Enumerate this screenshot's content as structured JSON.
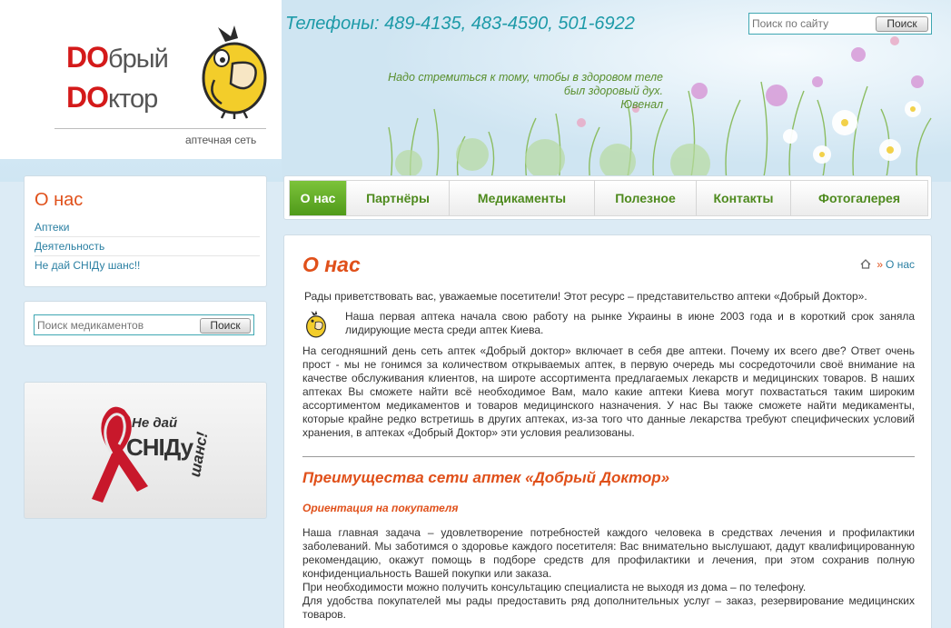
{
  "header": {
    "logo": {
      "line1_red": "DO",
      "line1_rest": "брый",
      "line2_red": "DO",
      "line2_rest": "ктор",
      "subtitle": "аптечная сеть"
    },
    "phones": "Телефоны: 489-4135, 483-4590, 501-6922",
    "quote": {
      "line1": "Надо стремиться к тому, чтобы в здоровом теле",
      "line2": "был здоровый дух.",
      "author": "Ювенал"
    },
    "search": {
      "placeholder": "Поиск по сайту",
      "button": "Поиск"
    }
  },
  "sidebar": {
    "about_title": "О нас",
    "items": [
      {
        "label": "Аптеки"
      },
      {
        "label": "Деятельность"
      },
      {
        "label": "Не дай СНІДу шанс!!"
      }
    ],
    "med_search": {
      "placeholder": "Поиск медикаментов",
      "button": "Поиск"
    },
    "banner": {
      "line1": "Не дай",
      "line2": "СНІДу",
      "line3": "шанс!"
    }
  },
  "nav": {
    "items": [
      {
        "label": "О нас",
        "active": true
      },
      {
        "label": "Партнёры"
      },
      {
        "label": "Медикаменты"
      },
      {
        "label": "Полезное"
      },
      {
        "label": "Контакты"
      },
      {
        "label": "Фотогалерея"
      }
    ]
  },
  "content": {
    "title": "О нас",
    "breadcrumb": {
      "sep": "»",
      "current": "О нас"
    },
    "intro": "Рады приветствовать вас, уважаемые посетители! Этот ресурс – представительство аптеки «Добрый Доктор».",
    "history": "Наша первая аптека начала свою работу на рынке Украины в июне 2003 года и в короткий срок заняла лидирующие места среди аптек Киева.",
    "today": "На сегодняшний день сеть аптек «Добрый доктор» включает в себя две аптеки. Почему их всего две? Ответ очень прост - мы не гонимся за количеством открываемых аптек, в первую очередь мы сосредоточили своё внимание на качестве обслуживания клиентов, на широте ассортимента предлагаемых лекарств и медицинских товаров. В наших аптеках Вы сможете найти всё необходимое Вам, мало какие аптеки Киева могут похвастаться таким широким ассортиментом медикаментов и товаров медицинского назначения. У нас Вы также сможете найти медикаменты, которые крайне редко встретишь в других аптеках, из-за того что данные лекарства требуют специфических условий хранения, в аптеках «Добрый Доктор» эти условия реализованы.",
    "advantages_title": "Преимущества сети аптек «Добрый Доктор»",
    "orientation_title": "Ориентация на покупателя",
    "task": "Наша главная задача – удовлетворение потребностей каждого человека в средствах лечения и профилактики заболеваний. Мы заботимся о здоровье каждого посетителя: Вас внимательно выслушают, дадут квалифицированную рекомендацию, окажут помощь в подборе средств для профилактики и лечения, при этом сохранив полную конфиденциальность Вашей покупки или заказа.",
    "phone_consult": "При необходимости можно получить консультацию специалиста не выходя из дома – по телефону.",
    "services": "Для удобства покупателей мы рады предоставить ряд дополнительных услуг – заказ, резервирование медицинских товаров."
  },
  "colors": {
    "accent_orange": "#e0501a",
    "nav_green": "#4e8a1e",
    "link_blue": "#2a7fa2",
    "teal": "#1d9aa8",
    "logo_red": "#d41a1a"
  }
}
